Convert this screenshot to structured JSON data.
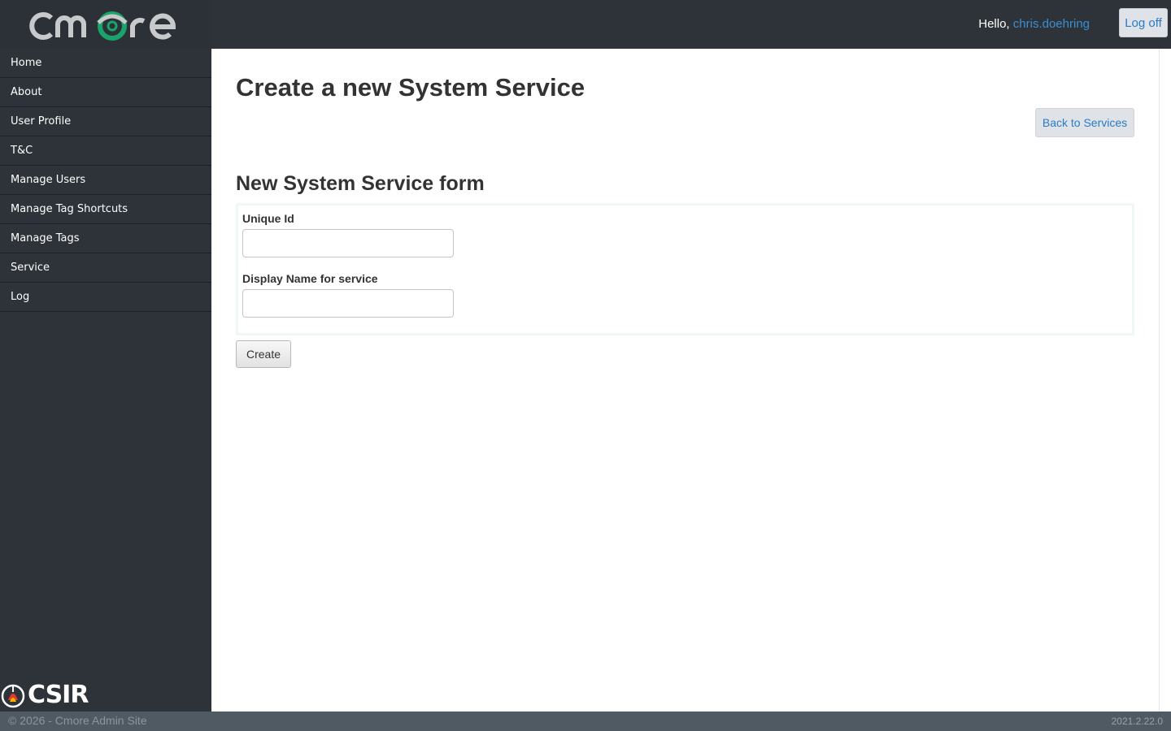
{
  "brand": {
    "logo_text": "cmore",
    "logo_color": "#c7c9ca",
    "logo_accent": "#1aa36b"
  },
  "sidebar": {
    "items": [
      {
        "label": "Home"
      },
      {
        "label": "About"
      },
      {
        "label": "User Profile"
      },
      {
        "label": "T&C"
      },
      {
        "label": "Manage Users"
      },
      {
        "label": "Manage Tag Shortcuts"
      },
      {
        "label": "Manage Tags"
      },
      {
        "label": "Service"
      },
      {
        "label": "Log"
      }
    ],
    "org_logo_text": "CSIR"
  },
  "header": {
    "greeting": "Hello,",
    "username": "chris.doehring",
    "logoff_label": "Log off"
  },
  "main": {
    "title": "Create a new System Service",
    "back_label": "Back to Services",
    "form_title": "New System Service form",
    "fields": [
      {
        "label": "Unique Id",
        "value": "",
        "placeholder": ""
      },
      {
        "label": "Display Name for service",
        "value": "",
        "placeholder": ""
      }
    ],
    "create_label": "Create"
  },
  "footer": {
    "copyright": "© 2026 - Cmore Admin Site",
    "version": "2021.2.22.0"
  },
  "colors": {
    "sidebar_bg": "#2d3339",
    "link": "#2a7ac6",
    "footer_bg": "#505a62"
  }
}
